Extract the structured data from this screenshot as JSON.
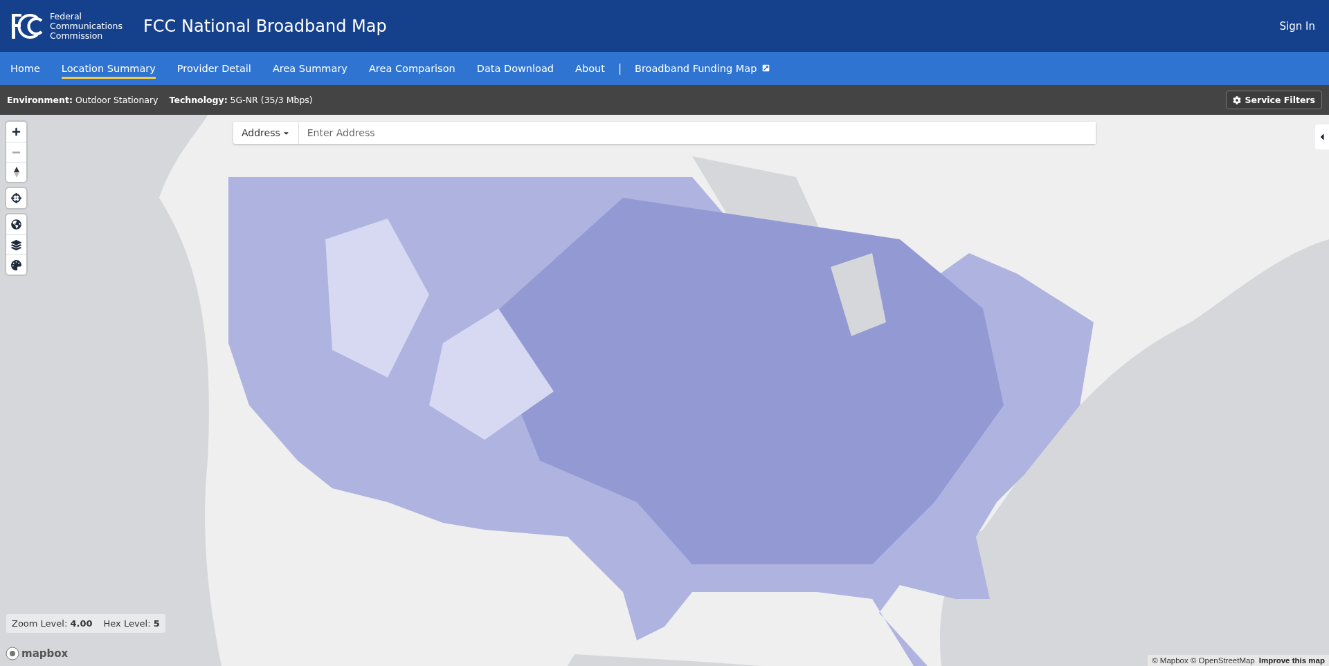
{
  "header": {
    "agency": [
      "Federal",
      "Communications",
      "Commission"
    ],
    "title": "FCC National Broadband Map",
    "sign_in": "Sign In"
  },
  "nav": {
    "items": [
      {
        "label": "Home",
        "selected": false
      },
      {
        "label": "Location Summary",
        "selected": true
      },
      {
        "label": "Provider Detail",
        "selected": false
      },
      {
        "label": "Area Summary",
        "selected": false
      },
      {
        "label": "Area Comparison",
        "selected": false
      },
      {
        "label": "Data Download",
        "selected": false
      },
      {
        "label": "About",
        "selected": false
      }
    ],
    "separator": "|",
    "external_link": "Broadband Funding Map"
  },
  "filters": {
    "items": [
      "**Environment:** Outdoor Stationary",
      "**Technology:** 5G-NR (35/3 Mbps)"
    ],
    "button": "Service Filters"
  },
  "search": {
    "type_button": "Address",
    "placeholder": "Enter Address"
  },
  "map": {
    "kind": "picture",
    "zoom_info": [
      "Zoom Level: **4.00**",
      "Hex Level: **5**"
    ],
    "logo": "mapbox",
    "attribution": "© Mapbox © OpenStreetMap",
    "improve_link": "Improve this map"
  }
}
